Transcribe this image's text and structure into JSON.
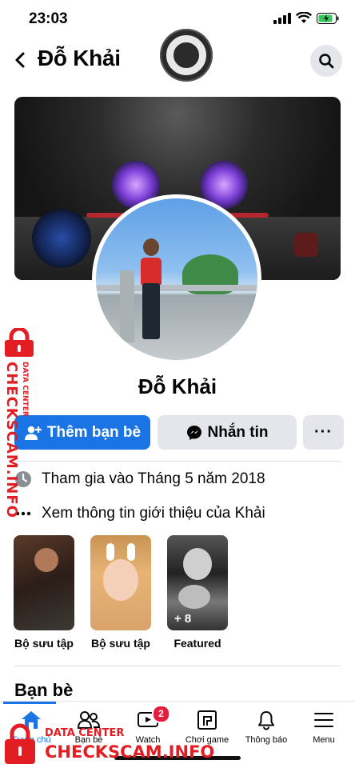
{
  "status_bar": {
    "time": "23:03"
  },
  "header": {
    "title": "Đỗ Khải"
  },
  "profile": {
    "name": "Đỗ Khải",
    "add_friend_label": "Thêm bạn bè",
    "message_label": "Nhắn tin",
    "more_label": "···"
  },
  "info": {
    "joined": "Tham gia vào Tháng 5 năm 2018",
    "about": "Xem thông tin giới thiệu của Khải"
  },
  "collections": [
    {
      "label": "Bộ sưu tập"
    },
    {
      "label": "Bộ sưu tập"
    },
    {
      "label": "Featured",
      "count": "+ 8"
    }
  ],
  "friends_section": {
    "title": "Bạn bè"
  },
  "tabbar": {
    "items": [
      {
        "label": "Trang chủ",
        "icon": "home-icon",
        "active": true
      },
      {
        "label": "Bạn bè",
        "icon": "friends-icon"
      },
      {
        "label": "Watch",
        "icon": "watch-icon",
        "badge": "2"
      },
      {
        "label": "Chơi game",
        "icon": "gaming-icon"
      },
      {
        "label": "Thông báo",
        "icon": "bell-icon"
      },
      {
        "label": "Menu",
        "icon": "menu-icon"
      }
    ]
  },
  "watermark": {
    "vertical_main": "CHECKSCAM.INFO",
    "vertical_sub": "DATA CENTER",
    "bottom_small": "DATA CENTER",
    "bottom_big": "CHECKSCAM.INFO"
  },
  "colors": {
    "primary": "#1b74e4",
    "secondary_button": "#e4e6eb",
    "badge": "#e41e3f",
    "watermark": "#e21d23"
  }
}
